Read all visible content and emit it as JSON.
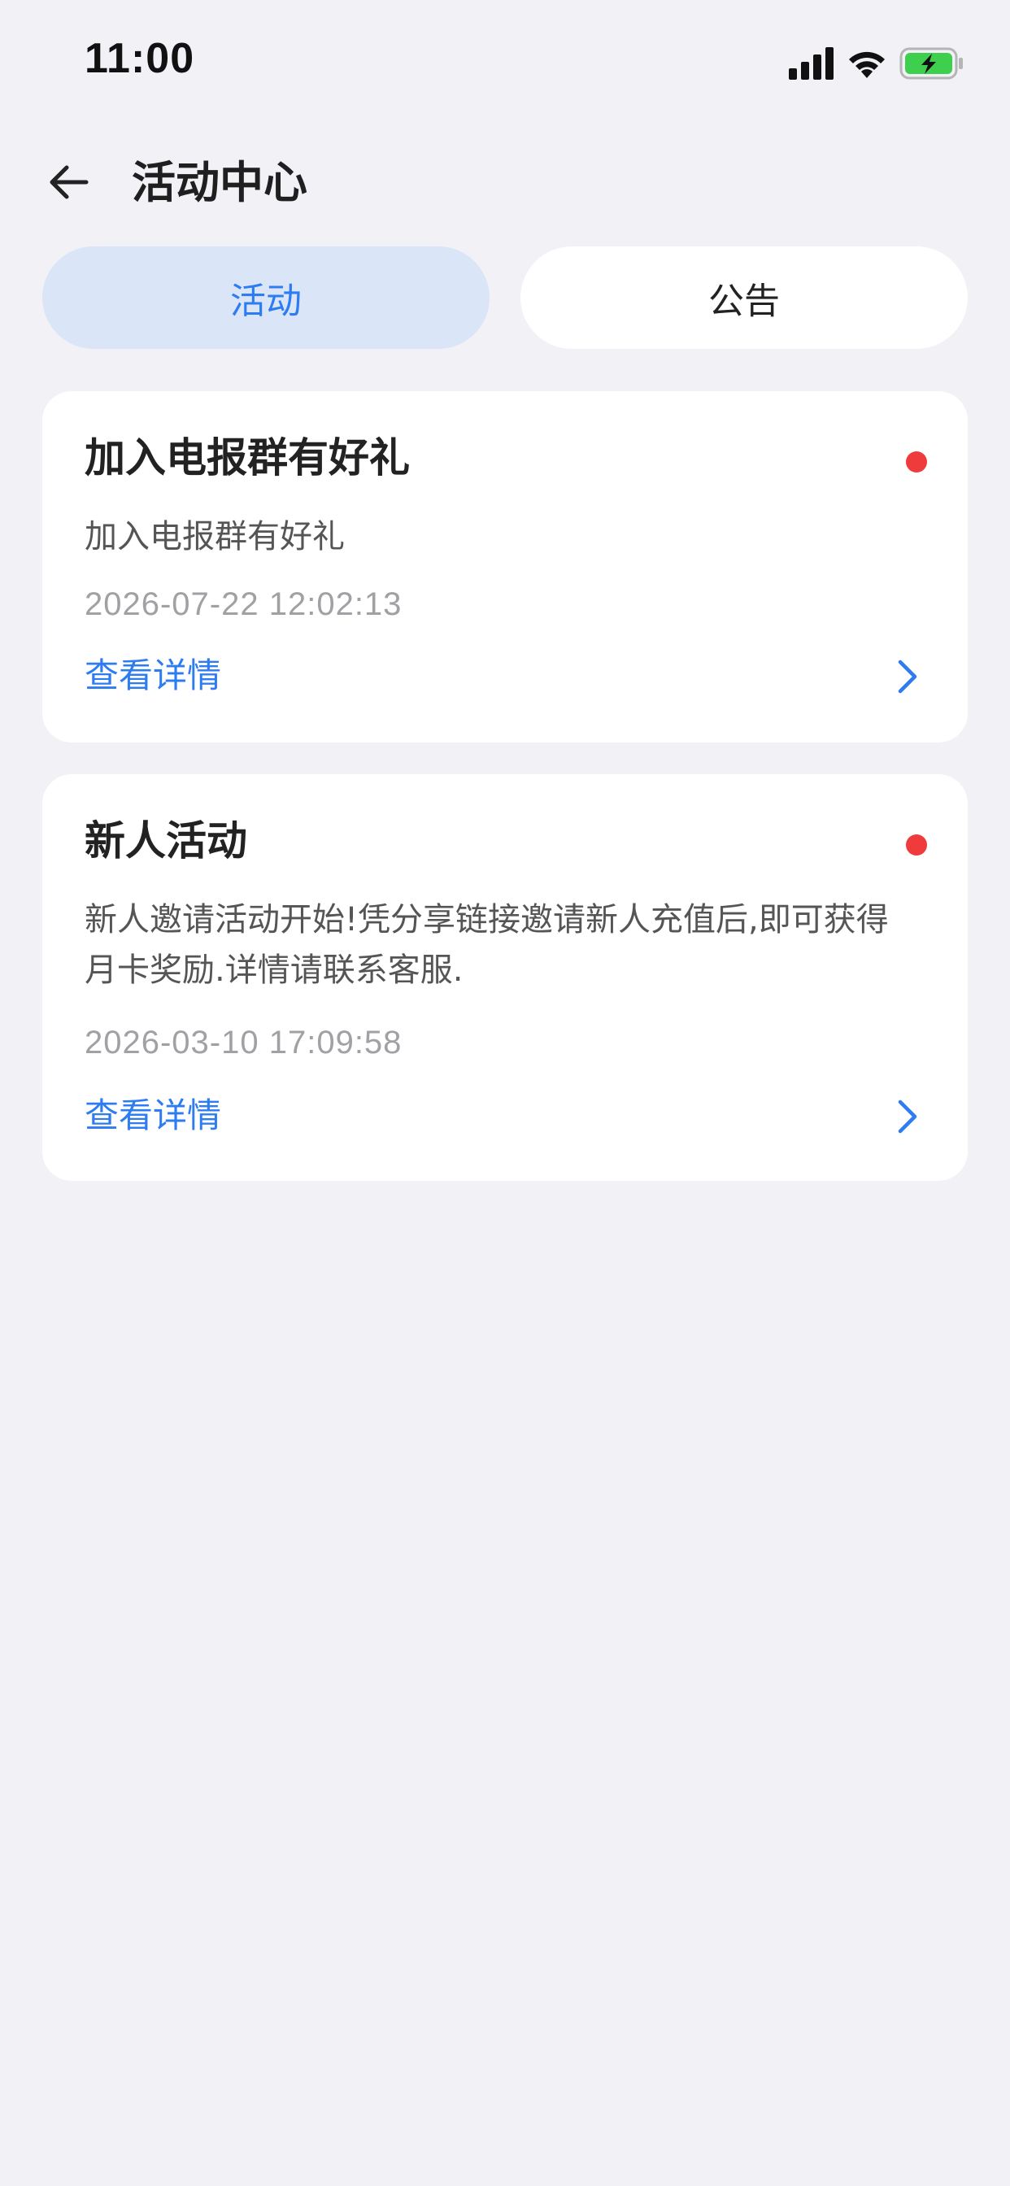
{
  "status_bar": {
    "time": "11:00",
    "icons": [
      "signal-icon",
      "wifi-icon",
      "battery-charging-icon"
    ]
  },
  "nav": {
    "back_icon": "arrow-left-icon",
    "title": "活动中心"
  },
  "tabs": [
    {
      "label": "活动",
      "active": true
    },
    {
      "label": "公告",
      "active": false
    }
  ],
  "cards": [
    {
      "title": "加入电报群有好礼",
      "description": "加入电报群有好礼",
      "time": "2026-07-22 12:02:13",
      "link_label": "查看详情",
      "unread": true
    },
    {
      "title": "新人活动",
      "description": "新人邀请活动开始!凭分享链接邀请新人充值后,即可获得月卡奖励.详情请联系客服.",
      "time": "2026-03-10 17:09:58",
      "link_label": "查看详情",
      "unread": true
    }
  ],
  "colors": {
    "background": "#f1f1f6",
    "accent": "#2d7cf2",
    "active_tab_bg": "#dbe5f8",
    "unread_dot": "#ef3b3b",
    "battery_green": "#3fcf4f"
  }
}
